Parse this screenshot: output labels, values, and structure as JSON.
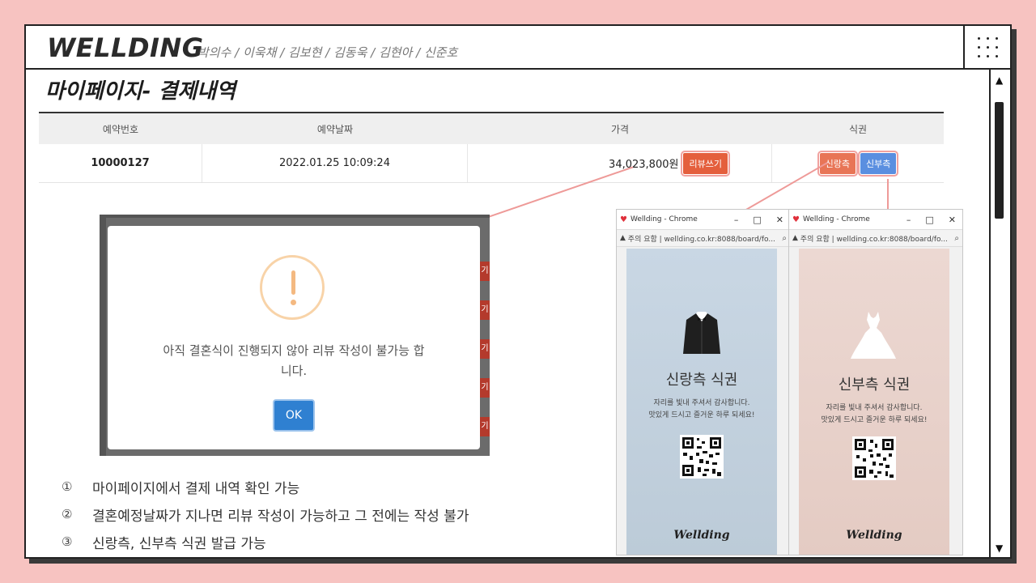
{
  "header": {
    "brand": "WELLDING",
    "team": "박의수 / 이욱채 / 김보현 / 김동욱 / 김현아 / 신준호"
  },
  "page": {
    "title": "마이페이지- 결제내역"
  },
  "table": {
    "headers": [
      "예약번호",
      "예약날짜",
      "가격",
      "식권"
    ],
    "row": {
      "order_no": "10000127",
      "date": "2022.01.25 10:09:24",
      "price": "34,023,800원",
      "review_button": "리뷰쓰기",
      "groom_button": "신랑측",
      "bride_button": "신부측"
    }
  },
  "modal": {
    "icon": "warning-icon",
    "message_line1": "아직 결혼식이 진행되지 않아 리뷰 작성이 불가능 합",
    "message_line2": "니다.",
    "ok": "OK",
    "side_tab": "기"
  },
  "notes": [
    {
      "num": "①",
      "text": "마이페이지에서 결제 내역 확인 가능"
    },
    {
      "num": "②",
      "text": "결혼예정날짜가 지나면 리뷰 작성이 가능하고 그 전에는 작성 불가"
    },
    {
      "num": "③",
      "text": "신랑측, 신부측 식권 발급 가능"
    }
  ],
  "popups": {
    "groom": {
      "window_title": "Wellding - Chrome",
      "url": "주의 요함 | wellding.co.kr:8088/board/fo...",
      "ticket_title": "신랑측 식권",
      "ticket_line1": "자리를 빛내 주셔서 감사합니다.",
      "ticket_line2": "맛있게 드시고 즐거운 하루 되세요!",
      "logo": "Wellding"
    },
    "bride": {
      "window_title": "Wellding - Chrome",
      "url": "주의 요함 | wellding.co.kr:8088/board/fo...",
      "ticket_title": "신부측 식권",
      "ticket_line1": "자리를 빛내 주셔서 감사합니다.",
      "ticket_line2": "맛있게 드시고 즐거운 하루 되세요!",
      "logo": "Wellding"
    }
  },
  "colors": {
    "background": "#f7c3c1",
    "review_button": "#e45f3d",
    "groom_button": "#e87556",
    "bride_button": "#5a8fe0",
    "ok_button": "#2f80d1",
    "callout_line": "#ee9a98"
  }
}
